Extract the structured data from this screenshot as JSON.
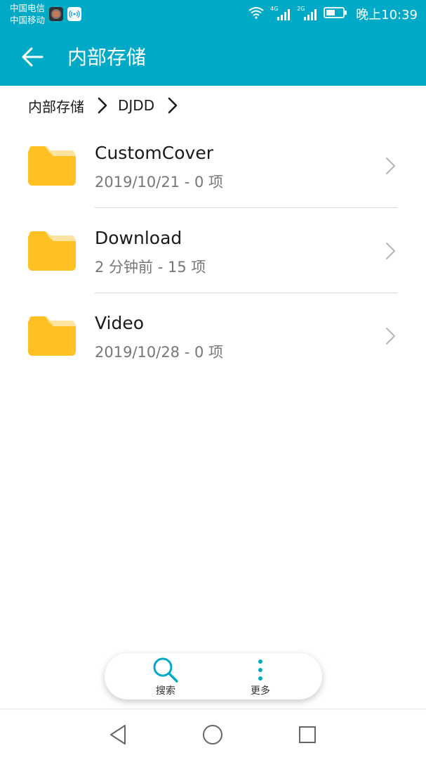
{
  "status_bar": {
    "carrier_1": "中国电信",
    "carrier_2": "中国移动",
    "network_1": "4G",
    "network_2": "2G",
    "time": "晚上10:39"
  },
  "app_bar": {
    "title": "内部存储",
    "back_icon": "arrow-left-icon"
  },
  "breadcrumb": {
    "items": [
      "内部存储",
      "DJDD"
    ]
  },
  "folders": [
    {
      "name": "CustomCover",
      "subtitle": "2019/10/21 - 0 项",
      "icon": "folder-icon"
    },
    {
      "name": "Download",
      "subtitle": "2 分钟前 - 15 项",
      "icon": "folder-icon"
    },
    {
      "name": "Video",
      "subtitle": "2019/10/28 - 0 项",
      "icon": "folder-icon"
    }
  ],
  "bottom_actions": {
    "search_label": "搜索",
    "more_label": "更多"
  },
  "nav_bar": {
    "back": "triangle-back-icon",
    "home": "circle-home-icon",
    "recents": "square-recents-icon"
  },
  "colors": {
    "accent": "#00a9c6",
    "folder": "#ffc024",
    "folder_tab": "#fde3a0"
  }
}
